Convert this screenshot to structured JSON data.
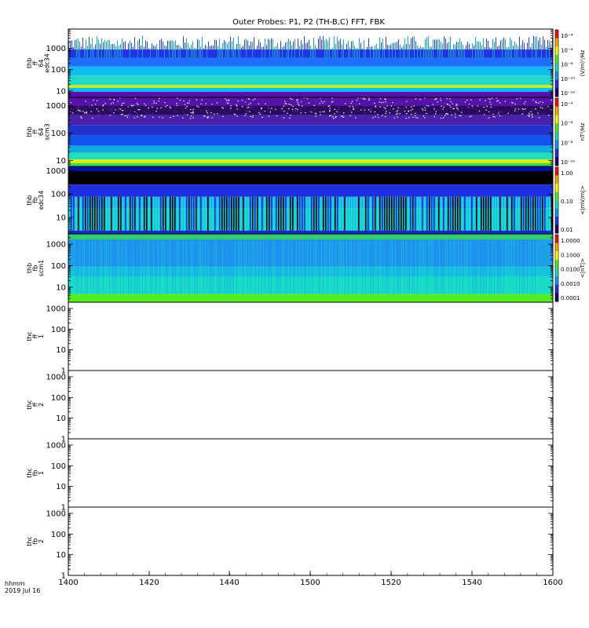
{
  "chart_data": {
    "type": "heatmap",
    "title": "Outer Probes: P1, P2 (TH-B,C) FFT, FBK",
    "x_ticks": [
      "1400",
      "1420",
      "1440",
      "1500",
      "1520",
      "1540",
      "1600"
    ],
    "x_footer": [
      "hhmm",
      "2019 Jul 16"
    ],
    "panels": [
      {
        "label": [
          "thb",
          "ff",
          "64",
          "edc34"
        ],
        "y_ticks": [
          "10",
          "100",
          "1000"
        ],
        "y_range": [
          5,
          8000
        ],
        "colorbar": {
          "labels": [
            "10⁻⁴",
            "10⁻⁶",
            "10⁻⁸",
            "10⁻¹⁰",
            "10⁻¹²"
          ],
          "unit": "(V/m)²/Hz"
        },
        "filled": true
      },
      {
        "label": [
          "thb",
          "ff",
          "64",
          "scm3"
        ],
        "y_ticks": [
          "10",
          "100",
          "1000"
        ],
        "y_range": [
          6,
          2000
        ],
        "colorbar": {
          "labels": [
            "10⁻⁴",
            "10⁻⁶",
            "10⁻⁸",
            "10⁻¹⁰"
          ],
          "unit": "nT²/Hz"
        },
        "filled": true
      },
      {
        "label": [
          "thb",
          "fb",
          "edc34"
        ],
        "y_ticks": [
          "10",
          "100",
          "1000"
        ],
        "y_range": [
          2,
          1500
        ],
        "colorbar": {
          "labels": [
            "1.00",
            "0.10",
            "0.01"
          ],
          "unit": "<|mV/m|>"
        },
        "filled": true
      },
      {
        "label": [
          "thb",
          "fb",
          "scm1"
        ],
        "y_ticks": [
          "10",
          "100",
          "1000"
        ],
        "y_range": [
          2,
          3000
        ],
        "colorbar": {
          "labels": [
            "1.0000",
            "0.1000",
            "0.0100",
            "0.0010",
            "0.0001"
          ],
          "unit": "<|nT|>"
        },
        "filled": true
      },
      {
        "label": [
          "thc",
          "ff",
          "1"
        ],
        "y_ticks": [
          "1",
          "10",
          "100",
          "1000"
        ],
        "y_range": [
          1,
          2000
        ],
        "filled": false
      },
      {
        "label": [
          "thc",
          "ff",
          "2"
        ],
        "y_ticks": [
          "1",
          "10",
          "100",
          "1000"
        ],
        "y_range": [
          1,
          2000
        ],
        "filled": false
      },
      {
        "label": [
          "thc",
          "fb",
          "1"
        ],
        "y_ticks": [
          "1",
          "10",
          "100",
          "1000"
        ],
        "y_range": [
          1,
          2000
        ],
        "filled": false
      },
      {
        "label": [
          "thc",
          "fb",
          "2"
        ],
        "y_ticks": [
          "1",
          "10",
          "100",
          "1000"
        ],
        "y_range": [
          1,
          2000
        ],
        "filled": false
      }
    ]
  }
}
